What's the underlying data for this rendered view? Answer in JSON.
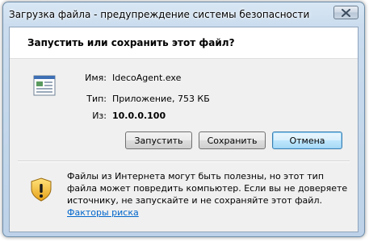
{
  "window": {
    "title": "Загрузка файла - предупреждение системы безопасности",
    "close_label": "✕"
  },
  "dialog": {
    "question": "Запустить или сохранить этот файл?",
    "file_icon": "executable-file-icon",
    "fields": {
      "name_label": "Имя:",
      "name_value": "IdecoAgent.exe",
      "type_label": "Тип:",
      "type_value": "Приложение, 753 КБ",
      "from_label": "Из:",
      "from_value": "10.0.0.100"
    },
    "buttons": {
      "run": "Запустить",
      "save": "Сохранить",
      "cancel": "Отмена"
    },
    "warning": {
      "icon": "shield-warning-icon",
      "text": "Файлы из Интернета могут быть полезны, но этот тип файла может повредить компьютер. Если вы не доверяете источнику, не запускайте и не сохраняйте этот файл. ",
      "link": "Факторы риска"
    }
  },
  "colors": {
    "frame": "#bdd2e8",
    "client_bg": "#f0f0f0",
    "link": "#0066cc",
    "default_button_border": "#3c7fb1"
  }
}
